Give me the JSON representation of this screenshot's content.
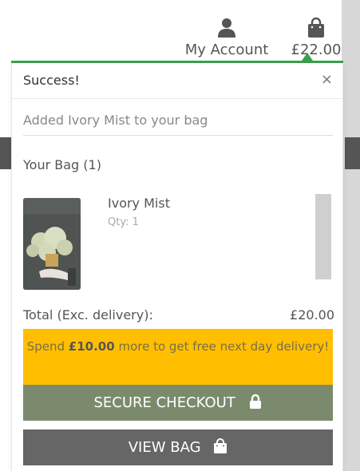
{
  "header": {
    "account_label": "My Account",
    "bag_total": "£22.00"
  },
  "toast": {
    "title": "Success!",
    "close_label": "×",
    "message": "Added Ivory Mist to your bag"
  },
  "bag": {
    "title": "Your Bag (1)",
    "items": [
      {
        "name": "Ivory Mist",
        "qty": "Qty: 1"
      }
    ],
    "total_label": "Total (Exc. delivery):",
    "total_value": "£20.00"
  },
  "promo": {
    "prefix": "Spend ",
    "amount": "£10.00",
    "suffix": " more to get free next day delivery!"
  },
  "buttons": {
    "checkout": "SECURE CHECKOUT",
    "view_bag": "VIEW BAG"
  },
  "colors": {
    "success": "#3aa14b",
    "promo_bg": "#ffbf00",
    "checkout_bg": "#7b8a6c",
    "viewbag_bg": "#666666"
  },
  "icons": {
    "account": "user-icon",
    "bag": "shopping-bag-icon",
    "checkout": "lock-icon",
    "view_bag": "shopping-bag-icon"
  }
}
